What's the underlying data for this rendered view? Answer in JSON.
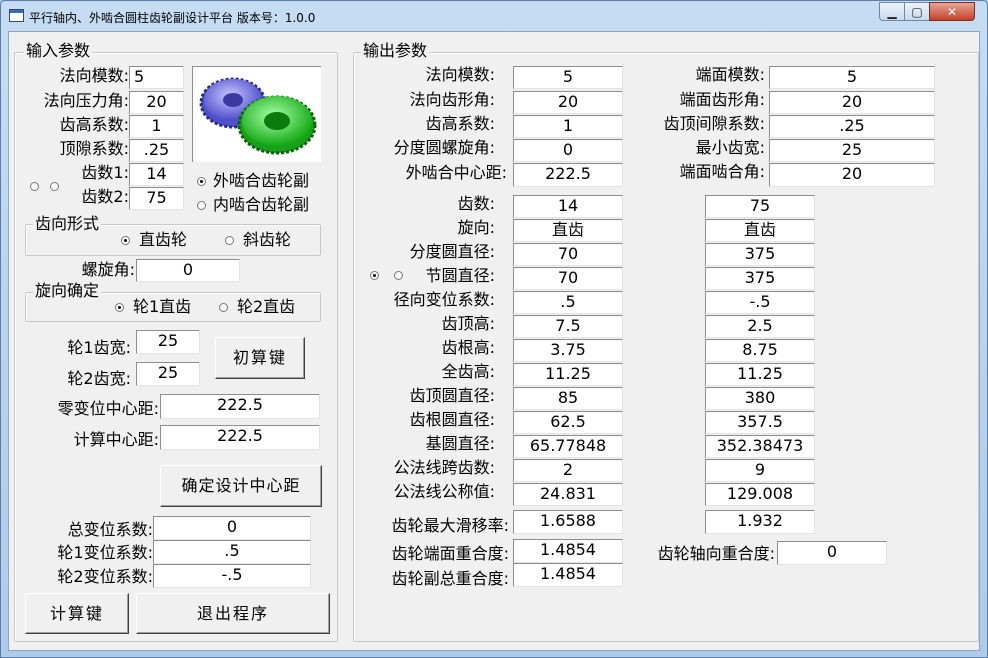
{
  "window": {
    "title": "平行轴内、外啮合圆柱齿轮副设计平台 版本号：1.0.0",
    "min": "▁",
    "max": "▢",
    "close": "✕"
  },
  "input": {
    "group_title": "输入参数",
    "normal_module": {
      "label": "法向模数:",
      "value": "5"
    },
    "pressure_angle": {
      "label": "法向压力角:",
      "value": "20"
    },
    "addendum_coef": {
      "label": "齿高系数:",
      "value": "1"
    },
    "clearance_coef": {
      "label": "顶隙系数:",
      "value": ".25"
    },
    "teeth1": {
      "label": "齿数1:",
      "value": "14"
    },
    "teeth2": {
      "label": "齿数2:",
      "value": "75"
    },
    "mesh": {
      "external": "外啮合齿轮副",
      "internal": "内啮合齿轮副",
      "selected": "external"
    },
    "tooth_dir": {
      "title": "齿向形式",
      "straight": "直齿轮",
      "helical": "斜齿轮",
      "selected": "straight"
    },
    "helix": {
      "label": "螺旋角:",
      "value": "0"
    },
    "hand": {
      "title": "旋向确定",
      "opt1": "轮1直齿",
      "opt2": "轮2直齿",
      "selected": "opt1"
    },
    "width1": {
      "label": "轮1齿宽:",
      "value": "25"
    },
    "width2": {
      "label": "轮2齿宽:",
      "value": "25"
    },
    "initial_calc": "初算键",
    "zero_center": {
      "label": "零变位中心距:",
      "value": "222.5"
    },
    "calc_center": {
      "label": "计算中心距:",
      "value": "222.5"
    },
    "confirm_center": "确定设计中心距",
    "total_shift": {
      "label": "总变位系数:",
      "value": "0"
    },
    "shift1": {
      "label": "轮1变位系数:",
      "value": ".5"
    },
    "shift2": {
      "label": "轮2变位系数:",
      "value": "-.5"
    },
    "calc_btn": "计算键",
    "exit_btn": "退出程序"
  },
  "output": {
    "group_title": "输出参数",
    "normal_module": {
      "label": "法向模数:",
      "value": "5"
    },
    "normal_profile": {
      "label": "法向齿形角:",
      "value": "20"
    },
    "addendum_coef": {
      "label": "齿高系数:",
      "value": "1"
    },
    "helix": {
      "label": "分度圆螺旋角:",
      "value": "0"
    },
    "ext_center": {
      "label": "外啮合中心距:",
      "value": "222.5"
    },
    "transverse_module": {
      "label": "端面模数:",
      "value": "5"
    },
    "transverse_profile": {
      "label": "端面齿形角:",
      "value": "20"
    },
    "tip_clearance": {
      "label": "齿顶间隙系数:",
      "value": ".25"
    },
    "min_teeth": {
      "label": "最小齿宽:",
      "value": "25"
    },
    "transverse_mesh": {
      "label": "端面啮合角:",
      "value": "20"
    },
    "rows": [
      {
        "label": "齿数:",
        "g1": "14",
        "g2": "75"
      },
      {
        "label": "旋向:",
        "g1": "直齿",
        "g2": "直齿"
      },
      {
        "label": "分度圆直径:",
        "g1": "70",
        "g2": "375"
      },
      {
        "label": "节圆直径:",
        "g1": "70",
        "g2": "375"
      },
      {
        "label": "径向变位系数:",
        "g1": ".5",
        "g2": "-.5"
      },
      {
        "label": "齿顶高:",
        "g1": "7.5",
        "g2": "2.5"
      },
      {
        "label": "齿根高:",
        "g1": "3.75",
        "g2": "8.75"
      },
      {
        "label": "全齿高:",
        "g1": "11.25",
        "g2": "11.25"
      },
      {
        "label": "齿顶圆直径:",
        "g1": "85",
        "g2": "380"
      },
      {
        "label": "齿根圆直径:",
        "g1": "62.5",
        "g2": "357.5"
      },
      {
        "label": "基圆直径:",
        "g1": "65.77848",
        "g2": "352.38473"
      },
      {
        "label": "公法线跨齿数:",
        "g1": "2",
        "g2": "9"
      },
      {
        "label": "公法线公称值:",
        "g1": "24.831",
        "g2": "129.008"
      }
    ],
    "max_slip": {
      "label": "齿轮最大滑移率:",
      "g1": "1.6588",
      "g2": "1.932"
    },
    "transverse_contact": {
      "label": "齿轮端面重合度:",
      "value": "1.4854"
    },
    "axial_contact": {
      "label": "齿轮轴向重合度:",
      "value": "0"
    },
    "total_contact": {
      "label": "齿轮副总重合度:",
      "value": "1.4854"
    }
  }
}
